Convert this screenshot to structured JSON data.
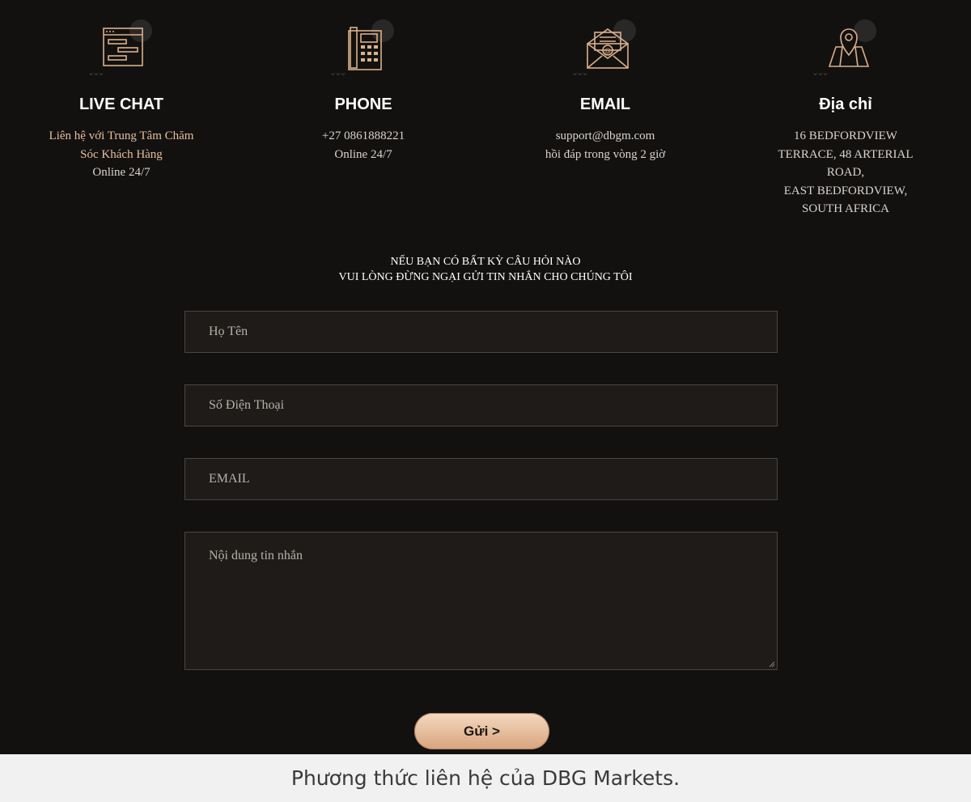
{
  "contacts": [
    {
      "icon": "chat-icon",
      "title": "LIVE CHAT",
      "lines": [
        "Liên hệ với Trung Tâm Chăm",
        "Sóc Khách Hàng",
        "Online 24/7"
      ]
    },
    {
      "icon": "phone-icon",
      "title": "PHONE",
      "lines": [
        "+27 0861888221",
        "Online 24/7"
      ]
    },
    {
      "icon": "envelope-icon",
      "title": "EMAIL",
      "lines": [
        "support@dbgm.com",
        "hồi đáp trong vòng 2 giờ"
      ]
    },
    {
      "icon": "map-pin-icon",
      "title": "Địa chỉ",
      "lines": [
        "16 BEDFORDVIEW",
        "TERRACE, 48 ARTERIAL",
        "ROAD,",
        "EAST BEDFORDVIEW,",
        "SOUTH AFRICA"
      ]
    }
  ],
  "form": {
    "heading_line1": "NẾU BẠN CÓ BẤT KỲ CÂU HỎI NÀO",
    "heading_line2": "VUI LÒNG ĐỪNG NGẠI GỬI TIN NHẮN CHO CHÚNG TÔI",
    "name_placeholder": "Họ Tên",
    "phone_placeholder": "Số Điện Thoại",
    "email_placeholder": "EMAIL",
    "message_placeholder": "Nội dung tin nhắn",
    "submit_label": "Gửi >"
  },
  "caption": "Phương thức liên hệ của DBG Markets.",
  "colors": {
    "background": "#131110",
    "accent_gold": "#e4c09c",
    "field_bg": "#1e1b19",
    "button": "#dcae88",
    "caption_bg": "#f1f1f1"
  }
}
